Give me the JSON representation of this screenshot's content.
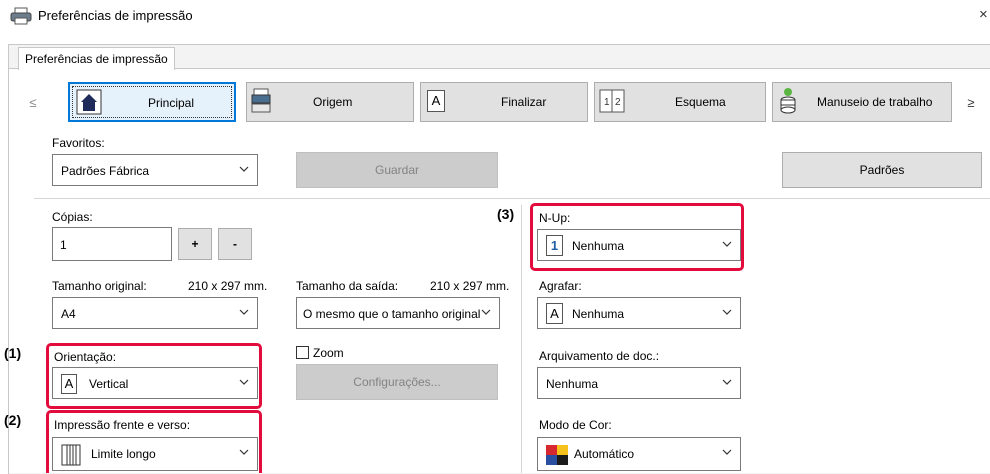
{
  "window": {
    "title": "Preferências de impressão",
    "close_glyph": "×"
  },
  "tab": {
    "label": "Preferências de impressão"
  },
  "nav": {
    "prev": "≤",
    "next": "≥",
    "items": [
      {
        "label": "Principal",
        "icon": "home-icon",
        "active": true
      },
      {
        "label": "Origem",
        "icon": "paper-tray-icon",
        "active": false
      },
      {
        "label": "Finalizar",
        "icon": "finish-letter-icon",
        "active": false
      },
      {
        "label": "Esquema",
        "icon": "layout-icon",
        "active": false
      },
      {
        "label": "Manuseio de trabalho",
        "icon": "job-stack-icon",
        "active": false
      }
    ]
  },
  "favorites": {
    "label": "Favoritos:",
    "value": "Padrões Fábrica",
    "save_label": "Guardar",
    "defaults_label": "Padrões"
  },
  "copies": {
    "label": "Cópias:",
    "value": "1",
    "plus": "+",
    "minus": "-"
  },
  "original_size": {
    "label": "Tamanho original:",
    "dims": "210 x 297 mm.",
    "value": "A4"
  },
  "output_size": {
    "label": "Tamanho da saída:",
    "dims": "210 x 297 mm.",
    "value": "O mesmo que o tamanho original"
  },
  "orientation": {
    "label": "Orientação:",
    "value": "Vertical",
    "icon_letter": "A"
  },
  "zoom": {
    "label": "Zoom",
    "checked": false,
    "settings_label": "Configurações..."
  },
  "duplex": {
    "label": "Impressão frente e verso:",
    "value": "Limite longo"
  },
  "nup": {
    "label": "N-Up:",
    "value": "Nenhuma",
    "icon_digit": "1"
  },
  "staple": {
    "label": "Agrafar:",
    "value": "Nenhuma",
    "icon_letter": "A"
  },
  "doc_filing": {
    "label": "Arquivamento de doc.:",
    "value": "Nenhuma"
  },
  "color_mode": {
    "label": "Modo de Cor:",
    "value": "Automático"
  },
  "callouts": {
    "c1": "(1)",
    "c2": "(2)",
    "c3": "(3)"
  },
  "colors": {
    "highlight": "#e30b3c",
    "active_tab_border": "#0078d7"
  }
}
